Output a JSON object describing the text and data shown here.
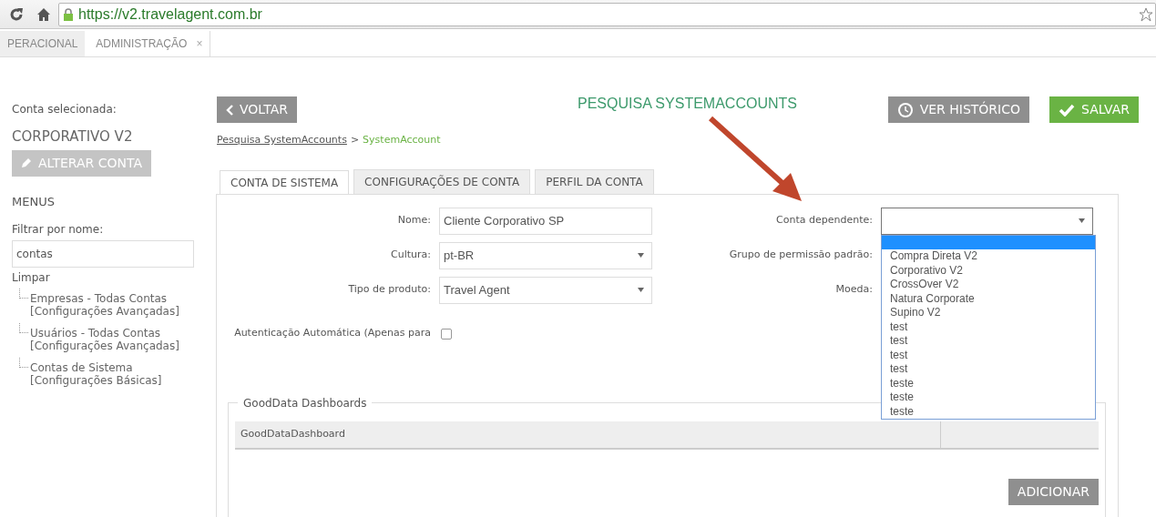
{
  "browser": {
    "url": "https://v2.travelagent.com.br"
  },
  "app_tabs": [
    {
      "label": "PERACIONAL",
      "selected": false
    },
    {
      "label": "ADMINISTRAÇÃO",
      "selected": true,
      "close": "×"
    }
  ],
  "sidebar": {
    "account_label": "Conta selecionada:",
    "account_name": "CORPORATIVO V2",
    "change_account_button": "ALTERAR CONTA",
    "menus_heading": "MENUS",
    "filter_label": "Filtrar por nome:",
    "filter_value": "contas",
    "clear_link": "Limpar",
    "menu_items": [
      {
        "label": "Empresas - Todas Contas [Configurações Avançadas]"
      },
      {
        "label": "Usuários - Todas Contas [Configurações Avançadas]"
      },
      {
        "label": "Contas de Sistema [Configurações Básicas]"
      }
    ]
  },
  "header": {
    "back_button": "VOLTAR",
    "title": "PESQUISA SYSTEMACCOUNTS",
    "history_button": "VER HISTÓRICO",
    "save_button": "SALVAR"
  },
  "breadcrumb": {
    "link": "Pesquisa SystemAccounts",
    "separator": ">",
    "current": "SystemAccount"
  },
  "tabs": [
    {
      "label": "CONTA DE SISTEMA",
      "selected": true
    },
    {
      "label": "CONFIGURAÇÕES DE CONTA",
      "selected": false
    },
    {
      "label": "PERFIL DA CONTA",
      "selected": false
    }
  ],
  "form_left": [
    {
      "kind": "text",
      "label": "Nome:",
      "value": "Cliente Corporativo SP"
    },
    {
      "kind": "select",
      "label": "Cultura:",
      "value": "pt-BR"
    },
    {
      "kind": "select",
      "label": "Tipo de produto:",
      "value": "Travel Agent"
    },
    {
      "kind": "checkbox",
      "label": "Autenticação Automática (Apenas para",
      "checked": false
    }
  ],
  "form_right": [
    {
      "kind": "select",
      "label": "Conta dependente:",
      "expanded": true,
      "blank_option_selected": true,
      "options": [
        {
          "label": "Compra Direta V2",
          "selected": false
        },
        {
          "label": "Corporativo V2",
          "selected": false
        },
        {
          "label": "CrossOver V2",
          "selected": false
        },
        {
          "label": "Natura Corporate",
          "selected": false
        },
        {
          "label": "Supino V2",
          "selected": false
        },
        {
          "label": "test",
          "selected": false
        },
        {
          "label": "test",
          "selected": false
        },
        {
          "label": "test",
          "selected": false
        },
        {
          "label": "test",
          "selected": false
        },
        {
          "label": "teste",
          "selected": false
        },
        {
          "label": "teste",
          "selected": false
        },
        {
          "label": "teste",
          "selected": false
        }
      ]
    },
    {
      "kind": "label_only",
      "label": "Grupo de permissão padrão:"
    },
    {
      "kind": "label_only",
      "label": "Moeda:"
    }
  ],
  "gooddata": {
    "legend": "GoodData Dashboards",
    "columns": [
      "GoodDataDashboard"
    ],
    "add_button": "ADICIONAR"
  }
}
